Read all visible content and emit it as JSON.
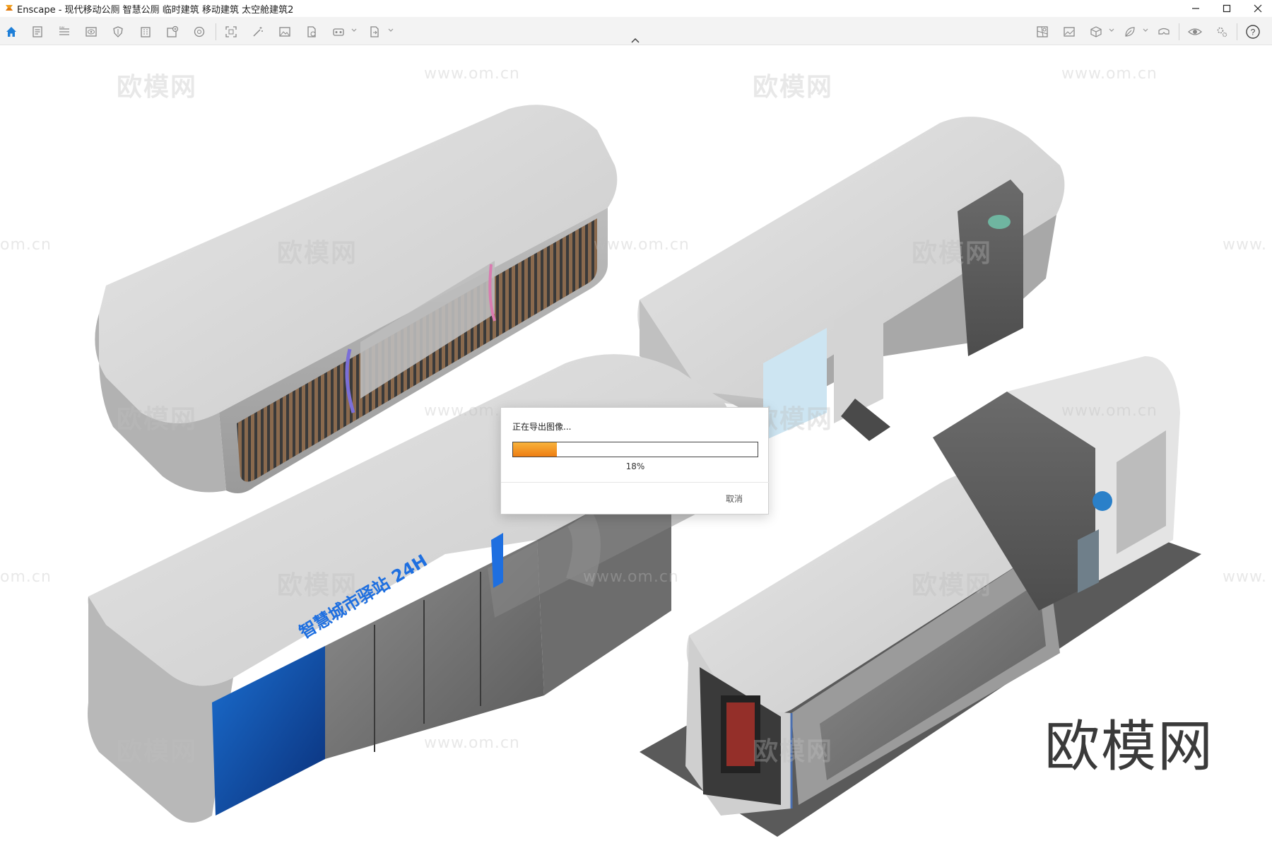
{
  "window": {
    "app_name": "Enscape",
    "title": "Enscape - 现代移动公厕 智慧公厕 临时建筑 移动建筑 太空舱建筑2",
    "controls": {
      "minimize": "—",
      "maximize": "☐",
      "close": "✕"
    }
  },
  "toolbar": {
    "left_icons": [
      "home-icon",
      "notes-icon",
      "bim-icon",
      "view-icon",
      "shield-icon",
      "building-icon",
      "asset-library-icon",
      "atmosphere-icon",
      "capture-icon",
      "magic-wand-icon",
      "image-icon",
      "file-export-icon",
      "vr-icon",
      "export-icon"
    ],
    "right_icons": [
      "map-icon",
      "gallery-icon",
      "cube-icon",
      "material-leaf-icon",
      "vr-headset-icon",
      "eye-icon",
      "settings-icon",
      "help-icon"
    ],
    "help_label": "?"
  },
  "watermarks": {
    "logo_text": "欧模网",
    "url_text": "www.om.cn",
    "url_partial_left": "om.cn",
    "url_partial_right": "www."
  },
  "scene": {
    "signage_text": "智慧城市驿站 24H",
    "brand_mark": "欧模网"
  },
  "dialog": {
    "title": "正在导出图像...",
    "progress": 0.18,
    "progress_label": "18%",
    "cancel_label": "取消",
    "accent_color": "#ee7d12"
  }
}
